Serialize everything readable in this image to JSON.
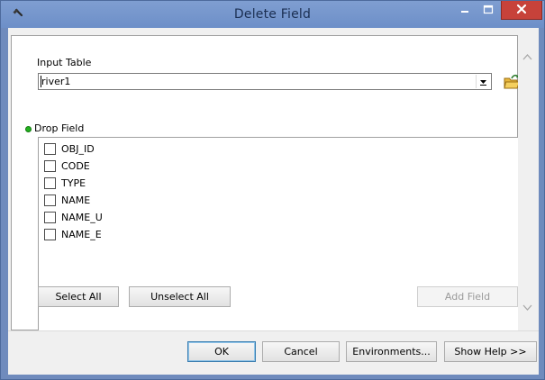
{
  "window": {
    "title": "Delete Field"
  },
  "input_table": {
    "label": "Input Table",
    "value": "river1"
  },
  "drop_field": {
    "label": "Drop Field",
    "fields": [
      {
        "name": "OBJ_ID",
        "checked": false
      },
      {
        "name": "CODE",
        "checked": false
      },
      {
        "name": "TYPE",
        "checked": false
      },
      {
        "name": "NAME",
        "checked": false
      },
      {
        "name": "NAME_U",
        "checked": false
      },
      {
        "name": "NAME_E",
        "checked": false
      }
    ]
  },
  "list_buttons": {
    "select_all": "Select All",
    "unselect_all": "Unselect All",
    "add_field": "Add Field"
  },
  "footer_buttons": {
    "ok": "OK",
    "cancel": "Cancel",
    "environments": "Environments...",
    "show_help": "Show Help >>"
  },
  "colors": {
    "title_bar": "#7f9ed1",
    "close_button": "#c7423a",
    "required_indicator": "#23b21f"
  },
  "icons": {
    "title": "hammer-icon",
    "browse": "open-folder-icon",
    "combo": "dropdown-arrow-icon"
  }
}
